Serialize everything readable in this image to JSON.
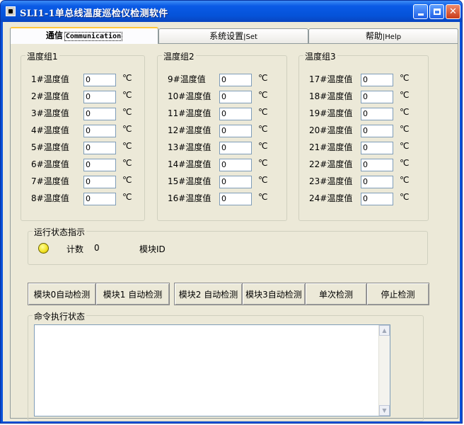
{
  "window": {
    "title": "SLI1-1单总线温度巡检仪检测软件",
    "controls": {
      "minimize": "minimize-icon",
      "maximize": "maximize-icon",
      "close": "close-icon"
    }
  },
  "tabs": [
    {
      "label": "通信",
      "sub": "Communication",
      "selected": true
    },
    {
      "label": "系统设置",
      "sub": "|Set"
    },
    {
      "label": "帮助",
      "sub": "|Help"
    }
  ],
  "groups": [
    {
      "title": "温度组1",
      "rows": [
        {
          "label": "1#温度值",
          "value": "0",
          "unit": "℃"
        },
        {
          "label": "2#温度值",
          "value": "0",
          "unit": "℃"
        },
        {
          "label": "3#温度值",
          "value": "0",
          "unit": "℃"
        },
        {
          "label": "4#温度值",
          "value": "0",
          "unit": "℃"
        },
        {
          "label": "5#温度值",
          "value": "0",
          "unit": "℃"
        },
        {
          "label": "6#温度值",
          "value": "0",
          "unit": "℃"
        },
        {
          "label": "7#温度值",
          "value": "0",
          "unit": "℃"
        },
        {
          "label": "8#温度值",
          "value": "0",
          "unit": "℃"
        }
      ]
    },
    {
      "title": "温度组2",
      "rows": [
        {
          "label": "9#温度值",
          "value": "0",
          "unit": "℃"
        },
        {
          "label": "10#温度值",
          "value": "0",
          "unit": "℃"
        },
        {
          "label": "11#温度值",
          "value": "0",
          "unit": "℃"
        },
        {
          "label": "12#温度值",
          "value": "0",
          "unit": "℃"
        },
        {
          "label": "13#温度值",
          "value": "0",
          "unit": "℃"
        },
        {
          "label": "14#温度值",
          "value": "0",
          "unit": "℃"
        },
        {
          "label": "15#温度值",
          "value": "0",
          "unit": "℃"
        },
        {
          "label": "16#温度值",
          "value": "0",
          "unit": "℃"
        }
      ]
    },
    {
      "title": "温度组3",
      "rows": [
        {
          "label": "17#温度值",
          "value": "0",
          "unit": "℃"
        },
        {
          "label": "18#温度值",
          "value": "0",
          "unit": "℃"
        },
        {
          "label": "19#温度值",
          "value": "0",
          "unit": "℃"
        },
        {
          "label": "20#温度值",
          "value": "0",
          "unit": "℃"
        },
        {
          "label": "21#温度值",
          "value": "0",
          "unit": "℃"
        },
        {
          "label": "22#温度值",
          "value": "0",
          "unit": "℃"
        },
        {
          "label": "23#温度值",
          "value": "0",
          "unit": "℃"
        },
        {
          "label": "24#温度值",
          "value": "0",
          "unit": "℃"
        }
      ]
    }
  ],
  "status": {
    "title": "运行状态指示",
    "count_label": "计数",
    "count_value": "0",
    "module_label": "模块ID",
    "led_color": "#f0e020"
  },
  "buttons": [
    {
      "label": "模块0自动检测"
    },
    {
      "label": "模块1 自动检测"
    },
    {
      "label": "模块2 自动检测"
    },
    {
      "label": "模块3自动检测"
    },
    {
      "label": "单次检测"
    },
    {
      "label": "停止检测"
    }
  ],
  "command": {
    "title": "命令执行状态",
    "text": ""
  }
}
